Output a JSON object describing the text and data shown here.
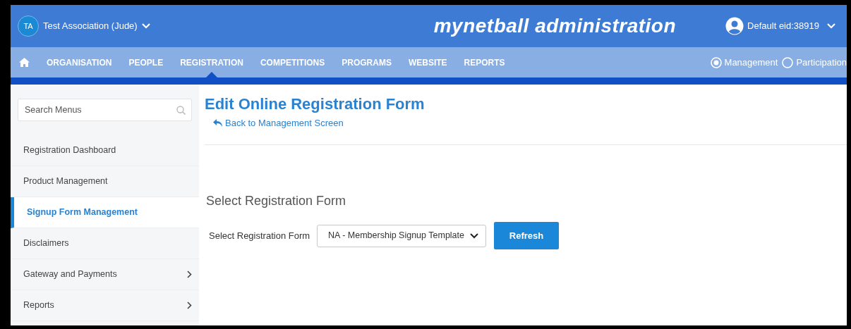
{
  "header": {
    "org_initials": "TA",
    "org_name": "Test Association (Jude)",
    "app_title": "mynetball administration",
    "user": "Default eid:38919"
  },
  "nav": [
    {
      "label": "ORGANISATION",
      "selected": false
    },
    {
      "label": "PEOPLE",
      "selected": false
    },
    {
      "label": "REGISTRATION",
      "selected": true
    },
    {
      "label": "COMPETITIONS",
      "selected": false
    },
    {
      "label": "PROGRAMS",
      "selected": false
    },
    {
      "label": "WEBSITE",
      "selected": false
    },
    {
      "label": "REPORTS",
      "selected": false
    }
  ],
  "mode": [
    {
      "label": "Management",
      "selected": true
    },
    {
      "label": "Participation",
      "selected": false
    }
  ],
  "sidebar": {
    "search": {
      "placeholder": "Search Menus"
    },
    "items": [
      {
        "label": "Registration Dashboard",
        "selected": false,
        "has_submenu": false
      },
      {
        "label": "Product Management",
        "selected": false,
        "has_submenu": false
      },
      {
        "label": "Signup Form Management",
        "selected": true,
        "has_submenu": false
      },
      {
        "label": "Disclaimers",
        "selected": false,
        "has_submenu": false
      },
      {
        "label": "Gateway and Payments",
        "selected": false,
        "has_submenu": true
      },
      {
        "label": "Reports",
        "selected": false,
        "has_submenu": true
      }
    ]
  },
  "content": {
    "title": "Edit Online Registration Form",
    "back_link": "Back to Management Screen",
    "section_title": "Select Registration Form",
    "field_label": "Select Registration Form",
    "select_value": "NA - Membership Signup Template",
    "button": "Refresh"
  }
}
